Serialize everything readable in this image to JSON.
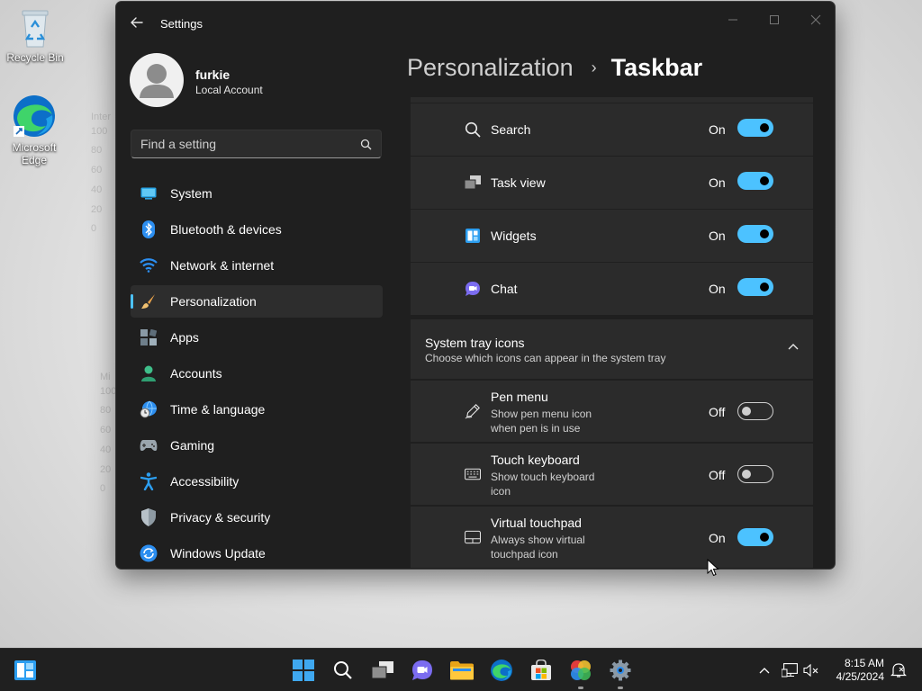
{
  "desktop": {
    "icons": [
      {
        "label": "Recycle Bin"
      },
      {
        "label": "Microsoft Edge"
      }
    ],
    "bg_chart_1": {
      "title": "Inter",
      "ticks": [
        "100",
        "80",
        "60",
        "40",
        "20",
        "0"
      ]
    },
    "bg_chart_2": {
      "title": "Mi",
      "ticks": [
        "100",
        "80",
        "60",
        "40",
        "20",
        "0"
      ]
    }
  },
  "window": {
    "title": "Settings",
    "user": {
      "name": "furkie",
      "account_type": "Local Account"
    },
    "search": {
      "placeholder": "Find a setting"
    },
    "nav": [
      {
        "label": "System",
        "icon": "monitor-icon"
      },
      {
        "label": "Bluetooth & devices",
        "icon": "bluetooth-icon"
      },
      {
        "label": "Network & internet",
        "icon": "wifi-icon"
      },
      {
        "label": "Personalization",
        "icon": "brush-icon",
        "active": true
      },
      {
        "label": "Apps",
        "icon": "apps-icon"
      },
      {
        "label": "Accounts",
        "icon": "person-icon"
      },
      {
        "label": "Time & language",
        "icon": "globe-clock-icon"
      },
      {
        "label": "Gaming",
        "icon": "gamepad-icon"
      },
      {
        "label": "Accessibility",
        "icon": "accessibility-icon"
      },
      {
        "label": "Privacy & security",
        "icon": "shield-icon"
      },
      {
        "label": "Windows Update",
        "icon": "update-icon"
      }
    ],
    "breadcrumb": {
      "parent": "Personalization",
      "separator": "›",
      "current": "Taskbar"
    },
    "taskbar_items": [
      {
        "label": "Search",
        "state": "On",
        "on": true,
        "icon": "search-icon"
      },
      {
        "label": "Task view",
        "state": "On",
        "on": true,
        "icon": "task-view-icon"
      },
      {
        "label": "Widgets",
        "state": "On",
        "on": true,
        "icon": "widgets-icon"
      },
      {
        "label": "Chat",
        "state": "On",
        "on": true,
        "icon": "chat-icon"
      }
    ],
    "system_tray": {
      "title": "System tray icons",
      "subtitle": "Choose which icons can appear in the system tray",
      "items": [
        {
          "label": "Pen menu",
          "desc": "Show pen menu icon when pen is in use",
          "state": "Off",
          "on": false,
          "icon": "pen-icon"
        },
        {
          "label": "Touch keyboard",
          "desc": "Show touch keyboard icon",
          "state": "Off",
          "on": false,
          "icon": "keyboard-icon"
        },
        {
          "label": "Virtual touchpad",
          "desc": "Always show virtual touchpad icon",
          "state": "On",
          "on": true,
          "icon": "touchpad-icon"
        }
      ]
    }
  },
  "taskbar": {
    "time": "8:15 AM",
    "date": "4/25/2024"
  },
  "colors": {
    "accent": "#4cc2ff",
    "window_bg": "#1f1f1f",
    "card_bg": "#2b2b2b",
    "taskbar_bg": "#202020"
  }
}
